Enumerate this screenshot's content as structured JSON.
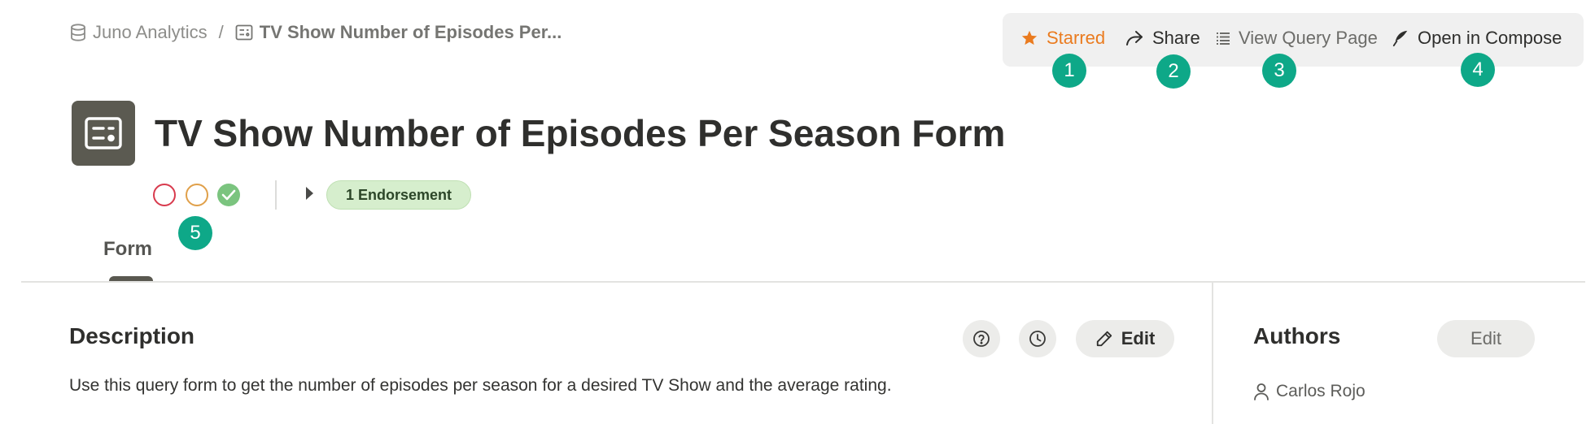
{
  "breadcrumb": {
    "workspace": "Juno Analytics",
    "workspace_icon": "database-icon",
    "separator": "/",
    "current": "TV Show Number of Episodes Per...",
    "current_icon": "form-icon"
  },
  "actions": {
    "starred": "Starred",
    "share": "Share",
    "view_query_page": "View Query Page",
    "open_in_compose": "Open in Compose"
  },
  "annotations": [
    "1",
    "2",
    "3",
    "4",
    "5"
  ],
  "page": {
    "title": "TV Show Number of Episodes Per Season Form",
    "icon": "form-icon"
  },
  "status": {
    "endorsement": "1 Endorsement"
  },
  "tabs": [
    {
      "label": "Form",
      "active": true
    }
  ],
  "description": {
    "heading": "Description",
    "edit_label": "Edit",
    "text": "Use this query form to get the number of episodes per season for a desired TV Show and the average rating."
  },
  "authors": {
    "heading": "Authors",
    "edit_label": "Edit",
    "list": [
      "Carlos Rojo"
    ]
  },
  "colors": {
    "starred": "#ea7b1f",
    "annotation_badge": "#0ea888",
    "endorsement_bg": "#d6eecd",
    "status_red": "#d83a4d",
    "status_orange": "#e0a04a",
    "status_green": "#7bc47f"
  }
}
